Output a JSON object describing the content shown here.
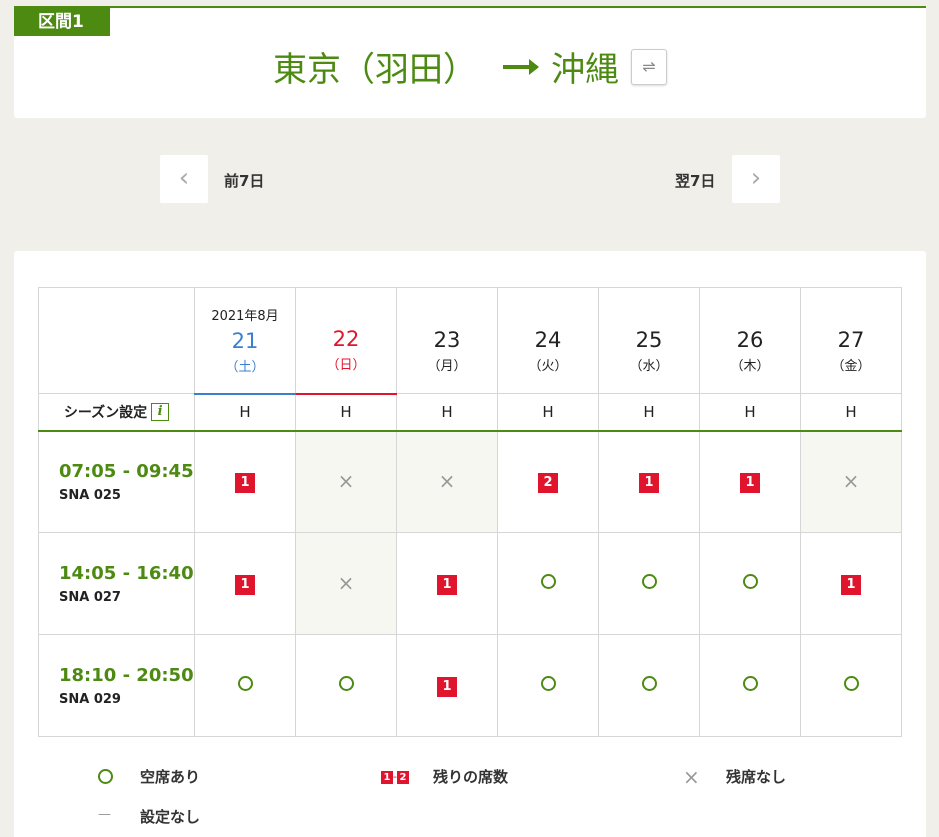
{
  "route": {
    "segment_label": "区間1",
    "origin": "東京（羽田）",
    "destination": "沖縄",
    "swap_icon": "⇌"
  },
  "nav": {
    "prev_icon": "‹",
    "prev_label": "前7日",
    "next_label": "翌7日",
    "next_icon": "›"
  },
  "calendar": {
    "month_label": "2021年8月",
    "season_label": "シーズン設定",
    "info_icon": "i",
    "days": [
      {
        "day": "21",
        "weekday": "（土）",
        "season": "H"
      },
      {
        "day": "22",
        "weekday": "（日）",
        "season": "H"
      },
      {
        "day": "23",
        "weekday": "（月）",
        "season": "H"
      },
      {
        "day": "24",
        "weekday": "（火）",
        "season": "H"
      },
      {
        "day": "25",
        "weekday": "（水）",
        "season": "H"
      },
      {
        "day": "26",
        "weekday": "（木）",
        "season": "H"
      },
      {
        "day": "27",
        "weekday": "（金）",
        "season": "H"
      }
    ]
  },
  "flights": [
    {
      "time": "07:05 - 09:45",
      "number": "SNA 025",
      "cells": [
        "1",
        "×",
        "×",
        "2",
        "1",
        "1",
        "×"
      ]
    },
    {
      "time": "14:05 - 16:40",
      "number": "SNA 027",
      "cells": [
        "1",
        "×",
        "1",
        "○",
        "○",
        "○",
        "1"
      ]
    },
    {
      "time": "18:10 - 20:50",
      "number": "SNA 029",
      "cells": [
        "○",
        "○",
        "1",
        "○",
        "○",
        "○",
        "○"
      ]
    }
  ],
  "legend": {
    "available_label": "空席あり",
    "remaining_badge_1": "1",
    "remaining_sep": "-",
    "remaining_badge_2": "2",
    "remaining_label": "残りの席数",
    "soldout_icon": "×",
    "soldout_label": "残席なし",
    "none_icon": "—",
    "none_label": "設定なし"
  },
  "colors": {
    "brand_green": "#4d8a12",
    "sold_red": "#e0152d",
    "saturday_blue": "#3a7fd0"
  }
}
